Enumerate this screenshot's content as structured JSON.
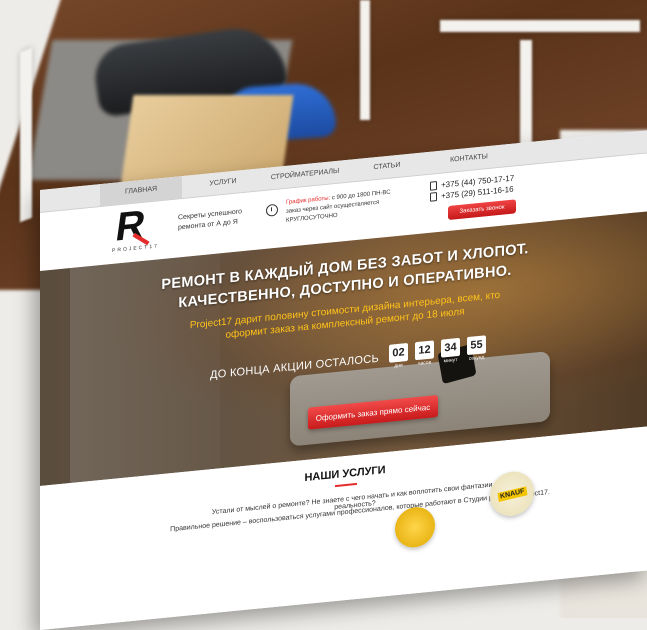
{
  "nav": {
    "items": [
      {
        "label": "ГЛАВНАЯ",
        "active": true
      },
      {
        "label": "УСЛУГИ",
        "active": false
      },
      {
        "label": "СТРОЙМАТЕРИАЛЫ",
        "active": false
      },
      {
        "label": "СТАТЬИ",
        "active": false
      },
      {
        "label": "КОНТАКТЫ",
        "active": false
      }
    ]
  },
  "header": {
    "logo_letter": "R",
    "logo_text": "PROJECT17",
    "tagline": "Секреты успешного ремонта от А до Я",
    "schedule_label": "График работы:",
    "schedule_hours": "с 900 до 1800 ПН-ВС",
    "schedule_note": "заказ через сайт осуществляется КРУГЛОСУТОЧНО",
    "phones": [
      "+375 (44) 750-17-17",
      "+375 (29) 511-16-16"
    ],
    "callback_label": "Заказать звонок"
  },
  "hero": {
    "headline": "РЕМОНТ В КАЖДЫЙ ДОМ БЕЗ ЗАБОТ И ХЛОПОТ. КАЧЕСТВЕННО, ДОСТУПНО И ОПЕРАТИВНО.",
    "promo": "Project17 дарит половину стоимости дизайна интерьера, всем, кто оформит заказ на комплексный ремонт до 18 июля",
    "countdown_label": "ДО КОНЦА АКЦИИ ОСТАЛОСЬ",
    "countdown": [
      {
        "value": "02",
        "unit": "дня"
      },
      {
        "value": "12",
        "unit": "часов"
      },
      {
        "value": "34",
        "unit": "минут"
      },
      {
        "value": "55",
        "unit": "секунд"
      }
    ],
    "cta_label": "Оформить заказ прямо сейчас"
  },
  "services": {
    "title": "НАШИ УСЛУГИ",
    "intro_1": "Устали от мыслей о ремонте? Не знаете с чего начать и как воплотить свои фантазии в реальность?",
    "intro_2": "Правильное решение – воспользоваться услугами профессионалов, которые работают в Студии ремонта Project17.",
    "partner_logo_text": "KNAUF"
  },
  "colors": {
    "accent": "#e52b2b",
    "promo": "#ffc219"
  }
}
